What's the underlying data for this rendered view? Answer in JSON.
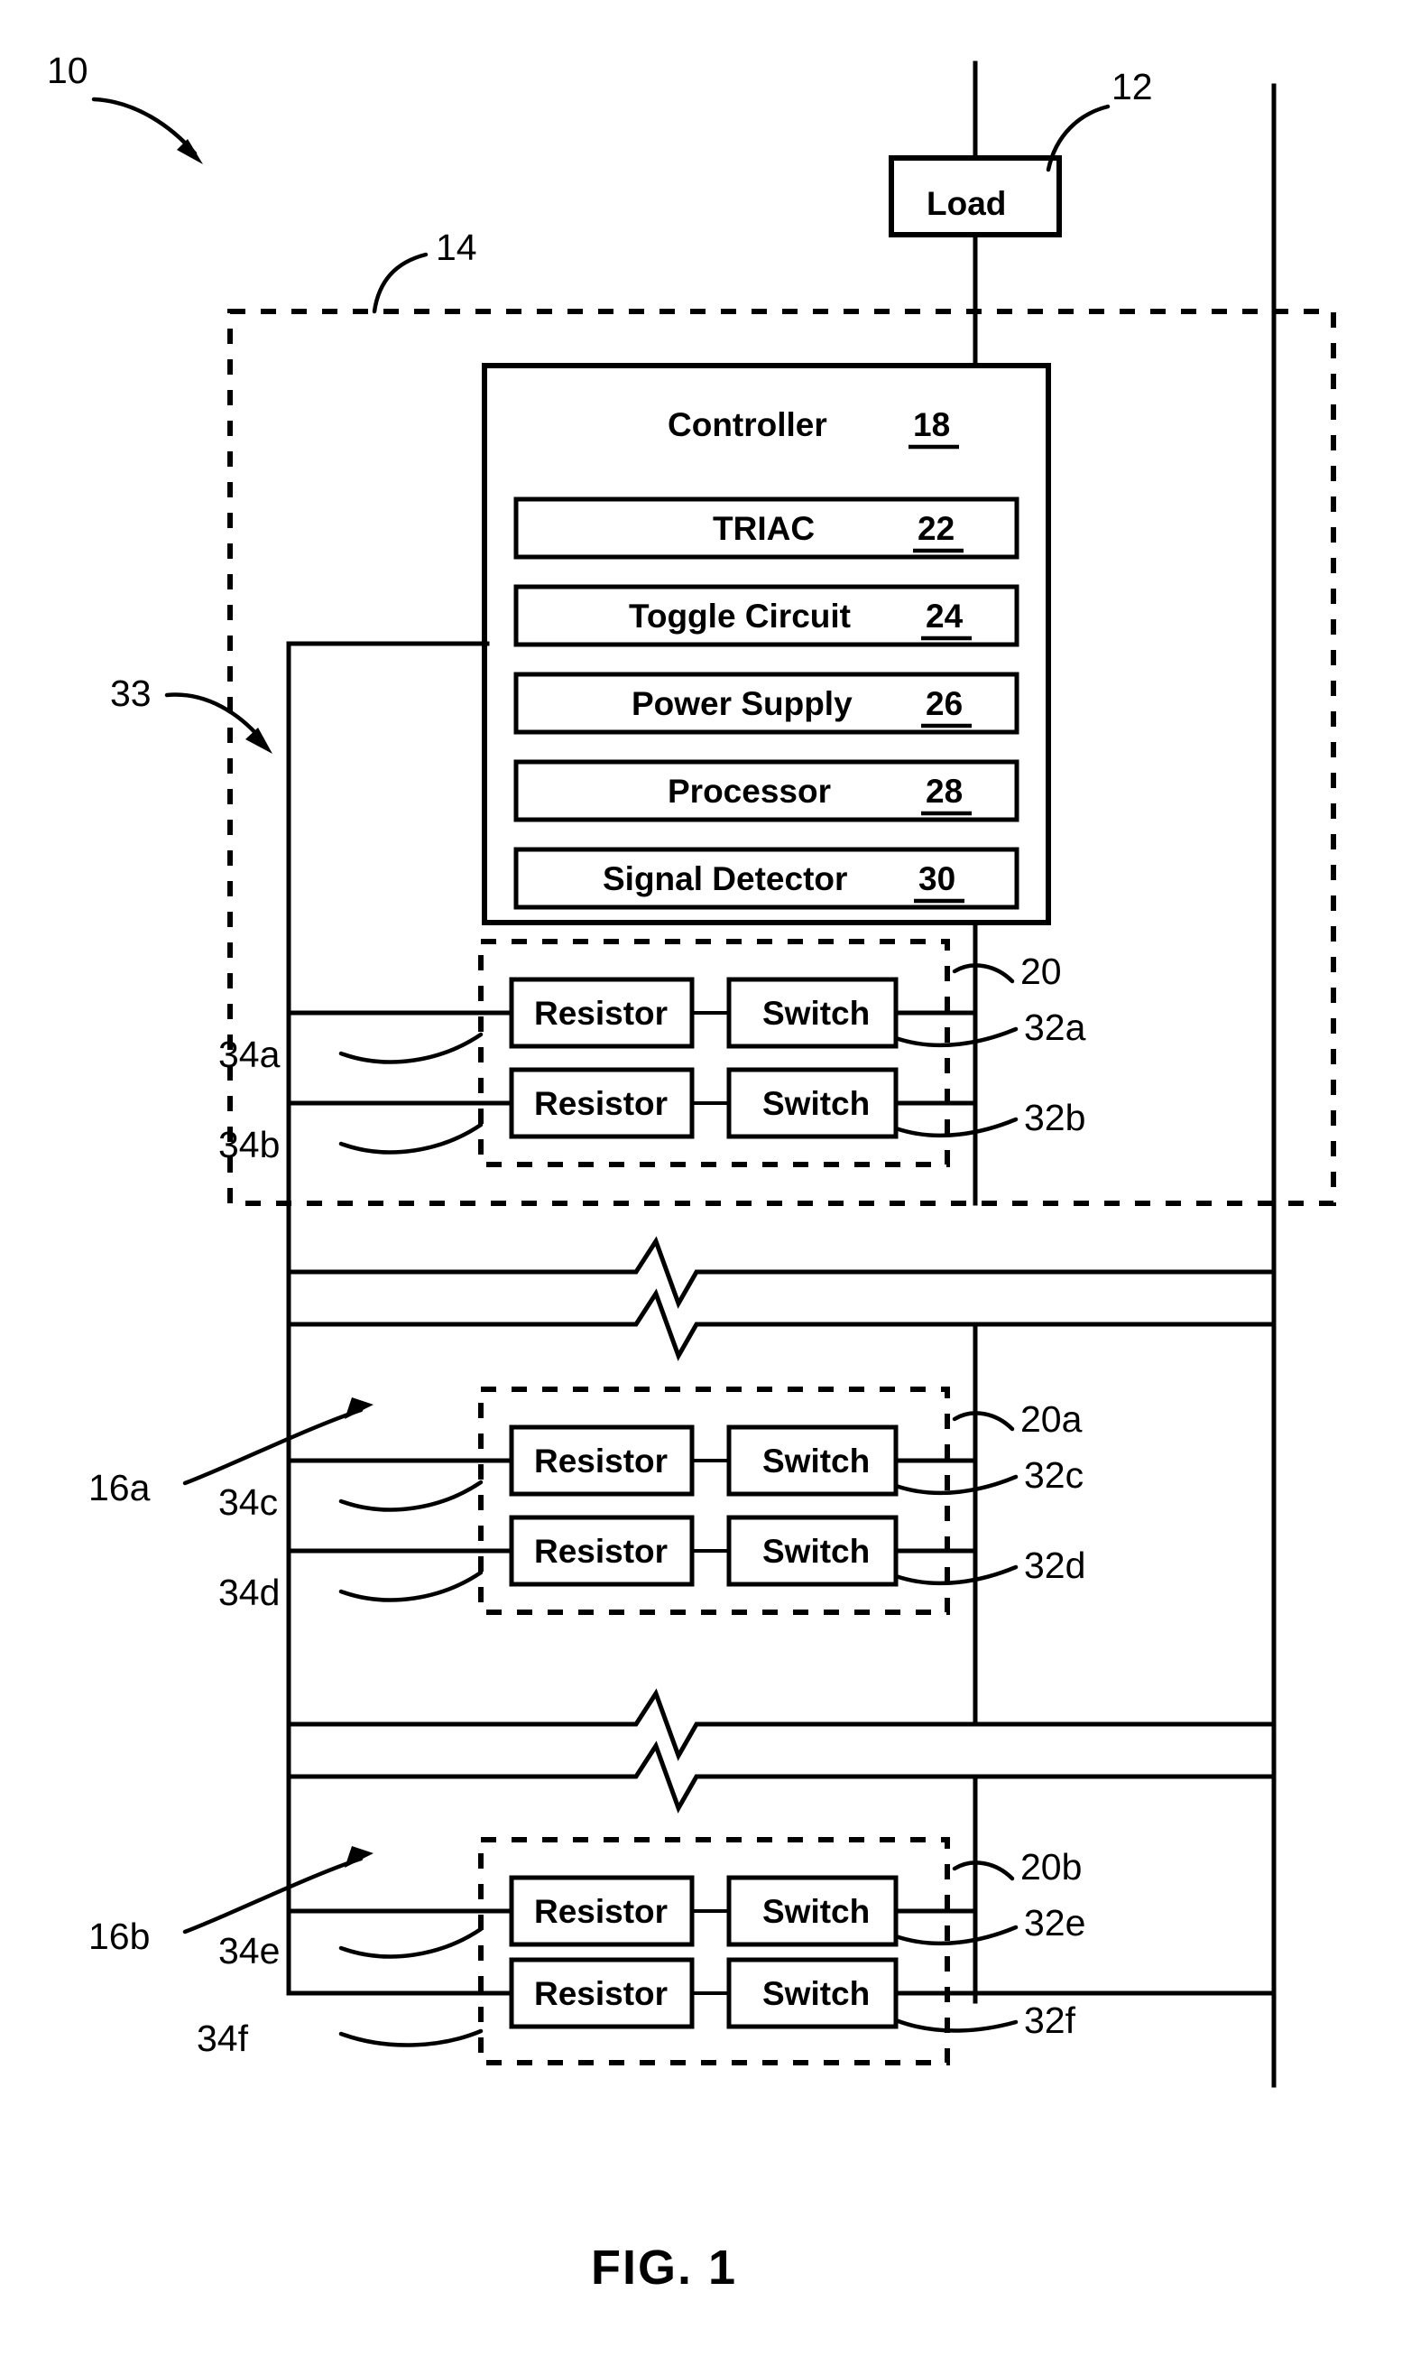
{
  "figure": {
    "caption": "FIG. 1",
    "load": {
      "label": "Load",
      "ref": "12"
    },
    "system_ref": "10",
    "enclosure_ref": "14",
    "bus_ref": "33",
    "controller": {
      "title": "Controller",
      "ref": "18",
      "modules": [
        {
          "label": "TRIAC",
          "ref": "22"
        },
        {
          "label": "Toggle Circuit",
          "ref": "24"
        },
        {
          "label": "Power Supply",
          "ref": "26"
        },
        {
          "label": "Processor",
          "ref": "28"
        },
        {
          "label": "Signal Detector",
          "ref": "30"
        }
      ]
    },
    "groups": [
      {
        "ref": "20",
        "station_ref": "",
        "rows": [
          {
            "resistor": "Resistor",
            "switch": "Switch",
            "resistor_ref": "34a",
            "switch_ref": "32a"
          },
          {
            "resistor": "Resistor",
            "switch": "Switch",
            "resistor_ref": "34b",
            "switch_ref": "32b"
          }
        ]
      },
      {
        "ref": "20a",
        "station_ref": "16a",
        "rows": [
          {
            "resistor": "Resistor",
            "switch": "Switch",
            "resistor_ref": "34c",
            "switch_ref": "32c"
          },
          {
            "resistor": "Resistor",
            "switch": "Switch",
            "resistor_ref": "34d",
            "switch_ref": "32d"
          }
        ]
      },
      {
        "ref": "20b",
        "station_ref": "16b",
        "rows": [
          {
            "resistor": "Resistor",
            "switch": "Switch",
            "resistor_ref": "34e",
            "switch_ref": "32e"
          },
          {
            "resistor": "Resistor",
            "switch": "Switch",
            "resistor_ref": "34f",
            "switch_ref": "32f"
          }
        ]
      }
    ]
  }
}
